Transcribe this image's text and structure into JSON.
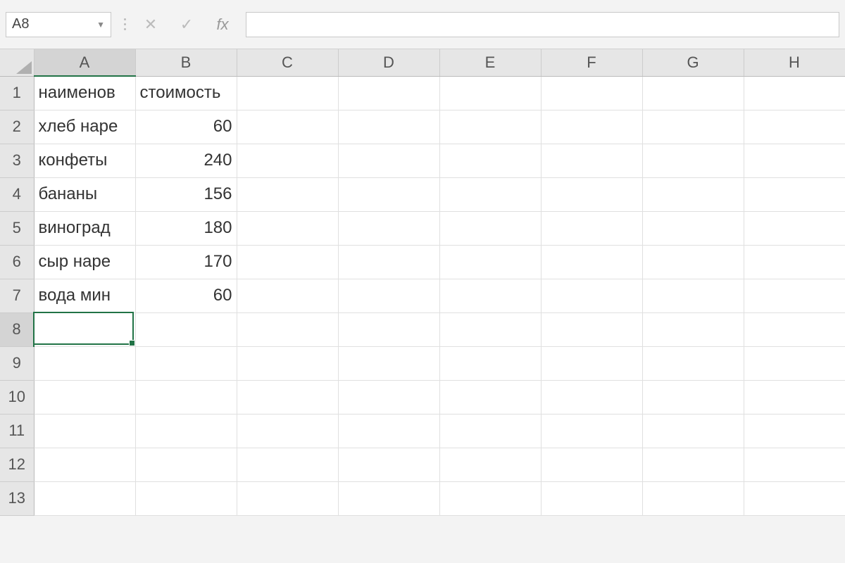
{
  "nameBox": "A8",
  "formulaBar": {
    "value": "",
    "cancelIcon": "✕",
    "enterIcon": "✓",
    "fxLabel": "fx"
  },
  "columns": [
    "A",
    "B",
    "C",
    "D",
    "E",
    "F",
    "G",
    "H"
  ],
  "rowCount": 13,
  "activeCell": {
    "col": "A",
    "row": 8
  },
  "colWidths": {
    "rowHeader": 48,
    "default": 144
  },
  "rowHeights": {
    "colHeader": 38,
    "default": 48
  },
  "cells": {
    "A1": {
      "v": "наименов",
      "t": "txt",
      "overflow": false
    },
    "B1": {
      "v": "стоимость",
      "t": "txt",
      "overflow": true
    },
    "A2": {
      "v": "хлеб наре",
      "t": "txt"
    },
    "B2": {
      "v": "60",
      "t": "num"
    },
    "A3": {
      "v": "конфеты",
      "t": "txt"
    },
    "B3": {
      "v": "240",
      "t": "num"
    },
    "A4": {
      "v": "бананы",
      "t": "txt"
    },
    "B4": {
      "v": "156",
      "t": "num"
    },
    "A5": {
      "v": "виноград",
      "t": "txt"
    },
    "B5": {
      "v": "180",
      "t": "num"
    },
    "A6": {
      "v": "сыр наре",
      "t": "txt"
    },
    "B6": {
      "v": "170",
      "t": "num"
    },
    "A7": {
      "v": "вода мин",
      "t": "txt"
    },
    "B7": {
      "v": "60",
      "t": "num"
    }
  }
}
